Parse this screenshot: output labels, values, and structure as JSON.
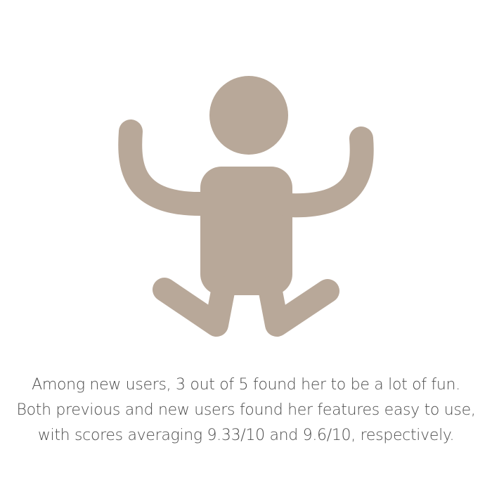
{
  "icon": {
    "name": "person-celebrating-icon",
    "color": "#b8a899"
  },
  "caption": {
    "lines": [
      "Among new users, 3 out of 5 found her to be a lot of fun.",
      "Both previous and new users found her features easy to use,",
      "with scores averaging 9.33/10 and 9.6/10, respectively."
    ]
  }
}
